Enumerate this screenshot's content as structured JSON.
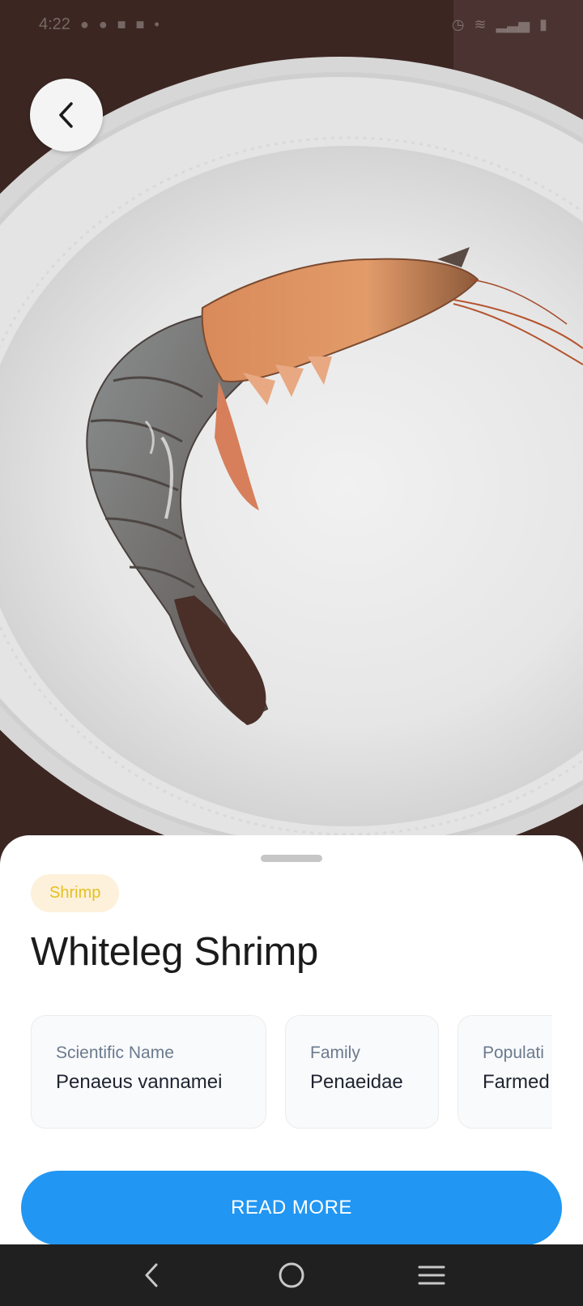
{
  "status_bar": {
    "time": "4:22",
    "left_icons": [
      "messenger-icon",
      "whatsapp-icon",
      "facebook-icon",
      "facebook-icon",
      "dot-icon"
    ],
    "right_icons": [
      "alarm-icon",
      "wifi-icon",
      "signal-icon",
      "battery-icon"
    ]
  },
  "photo": {
    "subject": "shrimp-on-plate-photo"
  },
  "back_button": {
    "icon": "chevron-left-icon"
  },
  "sheet": {
    "category": "Shrimp",
    "title": "Whiteleg Shrimp",
    "facts": [
      {
        "label": "Scientific Name",
        "value": "Penaeus vannamei"
      },
      {
        "label": "Family",
        "value": "Penaeidae"
      },
      {
        "label": "Populati",
        "value": "Farmed"
      }
    ],
    "read_more_label": "READ MORE"
  },
  "nav_bar": {
    "icons": [
      "back-icon",
      "home-icon",
      "recents-icon"
    ]
  },
  "colors": {
    "accent": "#2196f3",
    "chip_background": "#fdf1dc",
    "chip_text": "#e5c01d",
    "nav_background": "#202020"
  }
}
